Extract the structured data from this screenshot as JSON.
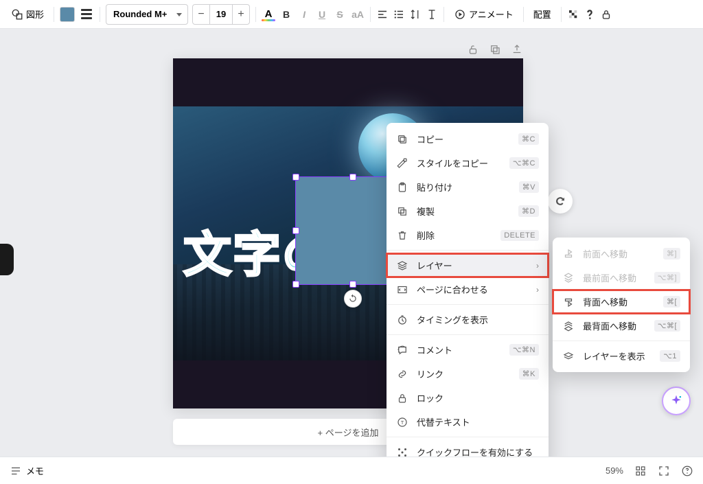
{
  "toolbar": {
    "shape_label": "図形",
    "font_name": "Rounded M+",
    "font_size": "19",
    "animate_label": "アニメート",
    "position_label": "配置",
    "text_color_letter": "A",
    "bold": "B",
    "italic": "I",
    "underline": "U",
    "strike": "S",
    "case": "aA"
  },
  "canvas": {
    "text_overlay": "文字の",
    "add_page": "+ ページを追加"
  },
  "context_menu": {
    "items": [
      {
        "icon": "copy",
        "label": "コピー",
        "shortcut": "⌘C"
      },
      {
        "icon": "style",
        "label": "スタイルをコピー",
        "shortcut": "⌥⌘C"
      },
      {
        "icon": "paste",
        "label": "貼り付け",
        "shortcut": "⌘V"
      },
      {
        "icon": "duplicate",
        "label": "複製",
        "shortcut": "⌘D"
      },
      {
        "icon": "trash",
        "label": "削除",
        "shortcut": "DELETE"
      },
      {
        "icon": "layers",
        "label": "レイヤー",
        "arrow": true,
        "highlighted": true
      },
      {
        "icon": "fit",
        "label": "ページに合わせる",
        "arrow": true
      },
      {
        "icon": "timing",
        "label": "タイミングを表示"
      },
      {
        "icon": "comment",
        "label": "コメント",
        "shortcut": "⌥⌘N"
      },
      {
        "icon": "link",
        "label": "リンク",
        "shortcut": "⌘K"
      },
      {
        "icon": "lock",
        "label": "ロック"
      },
      {
        "icon": "alt",
        "label": "代替テキスト"
      },
      {
        "icon": "flow",
        "label": "クイックフローを有効にする"
      }
    ]
  },
  "submenu": {
    "items": [
      {
        "icon": "forward",
        "label": "前面へ移動",
        "shortcut": "⌘]",
        "disabled": true
      },
      {
        "icon": "front",
        "label": "最前面へ移動",
        "shortcut": "⌥⌘]",
        "disabled": true
      },
      {
        "icon": "backward",
        "label": "背面へ移動",
        "shortcut": "⌘[",
        "highlighted": true
      },
      {
        "icon": "back",
        "label": "最背面へ移動",
        "shortcut": "⌥⌘["
      },
      {
        "icon": "show",
        "label": "レイヤーを表示",
        "shortcut": "⌥1"
      }
    ]
  },
  "bottom": {
    "notes_label": "メモ",
    "zoom": "59%"
  }
}
